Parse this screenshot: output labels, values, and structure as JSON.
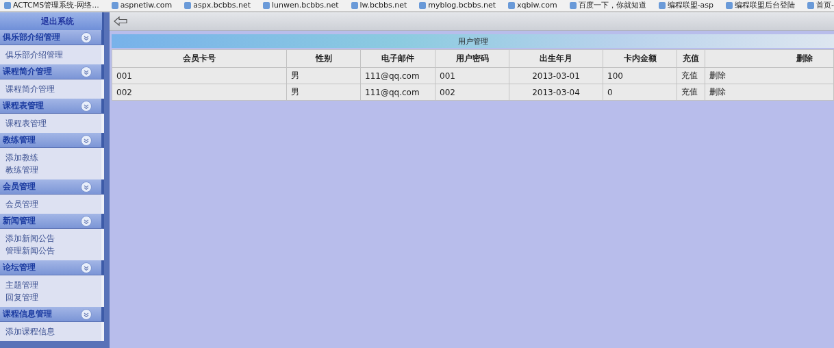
{
  "bookmarks": [
    "ACTCMS管理系统-网络...",
    "aspnetiw.com",
    "aspx.bcbbs.net",
    "lunwen.bcbbs.net",
    "lw.bcbbs.net",
    "myblog.bcbbs.net",
    "xqbiw.com",
    "百度一下，你就知道",
    "编程联盟-asp",
    "编程联盟后台登陆",
    "首页-"
  ],
  "logout": "退出系统",
  "sidebar": [
    {
      "title": "俱乐部介绍管理",
      "items": [
        "俱乐部介绍管理"
      ]
    },
    {
      "title": "课程简介管理",
      "items": [
        "课程简介管理"
      ]
    },
    {
      "title": "课程表管理",
      "items": [
        "课程表管理"
      ]
    },
    {
      "title": "教练管理",
      "items": [
        "添加教练",
        "教练管理"
      ]
    },
    {
      "title": "会员管理",
      "items": [
        "会员管理"
      ]
    },
    {
      "title": "新闻管理",
      "items": [
        "添加新闻公告",
        "管理新闻公告"
      ]
    },
    {
      "title": "论坛管理",
      "items": [
        "主题管理",
        "回复管理"
      ]
    },
    {
      "title": "课程信息管理",
      "items": [
        "添加课程信息"
      ]
    }
  ],
  "panel_title": "用户管理",
  "table": {
    "columns": [
      "会员卡号",
      "性别",
      "电子邮件",
      "用户密码",
      "出生年月",
      "卡内金额",
      "充值",
      "删除"
    ],
    "rows": [
      [
        "001",
        "男",
        "111@qq.com",
        "001",
        "2013-03-01",
        "100",
        "充值",
        "删除"
      ],
      [
        "002",
        "男",
        "111@qq.com",
        "002",
        "2013-03-04",
        "0",
        "充值",
        "删除"
      ]
    ]
  }
}
